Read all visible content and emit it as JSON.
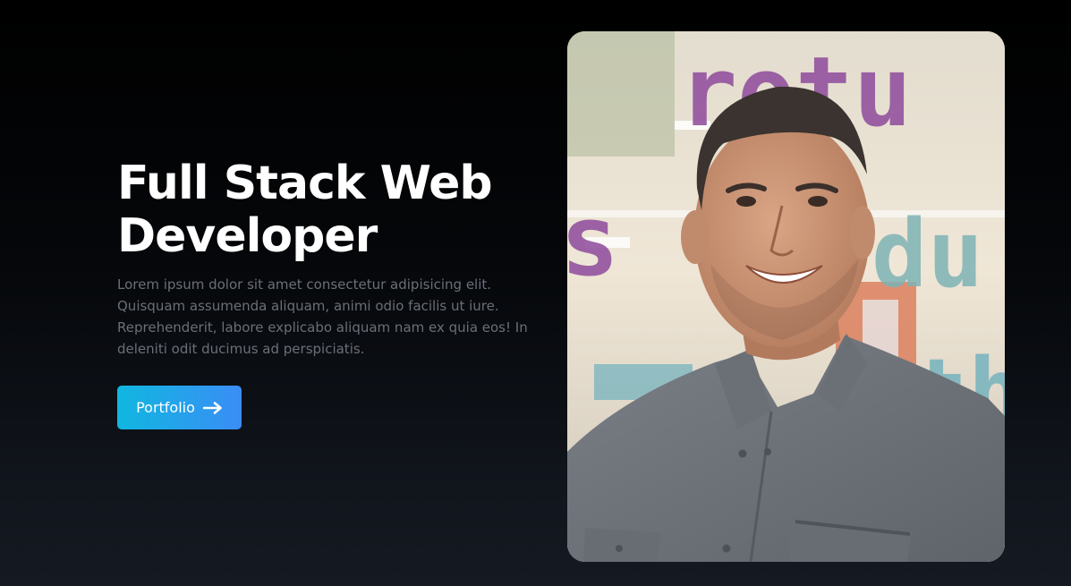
{
  "hero": {
    "title_line1": "Full Stack Web",
    "title_line2": "Developer",
    "description_line1": "Lorem ipsum dolor sit amet consectetur adipisicing elit.",
    "description_line2": "Quisquam assumenda aliquam, animi odio facilis ut iure.",
    "description_line3": "Reprehenderit, labore explicabo aliquam nam ex quia eos! In",
    "description_line4": "deleniti odit ducimus ad perspiciatis.",
    "button_label": "Portfolio",
    "button_icon": "arrow-right-icon",
    "photo_wall_text_top": "rotu",
    "photo_wall_text_left": "s",
    "photo_wall_text_right": "du",
    "photo_wall_text_bottom": "th"
  },
  "colors": {
    "background_top": "#000000",
    "background_bottom": "#151a22",
    "title": "#ffffff",
    "description": "#6b6f78",
    "button_gradient_start": "#10b7e0",
    "button_gradient_end": "#3a8df5"
  }
}
